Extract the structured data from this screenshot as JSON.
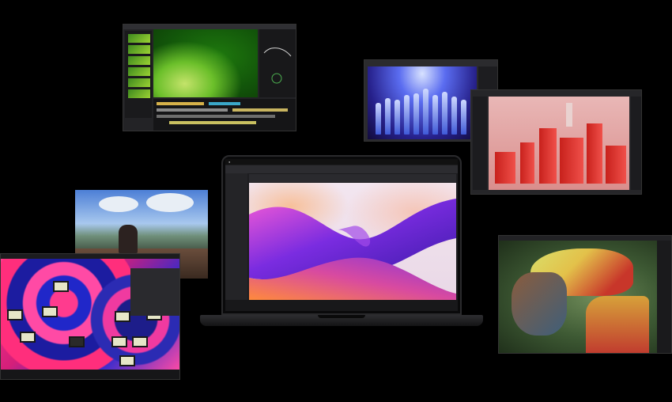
{
  "laptop": {
    "menubar_items": [
      "",
      "",
      "",
      "",
      "",
      "",
      "",
      ""
    ]
  },
  "icons": {
    "apple": "apple-icon"
  }
}
